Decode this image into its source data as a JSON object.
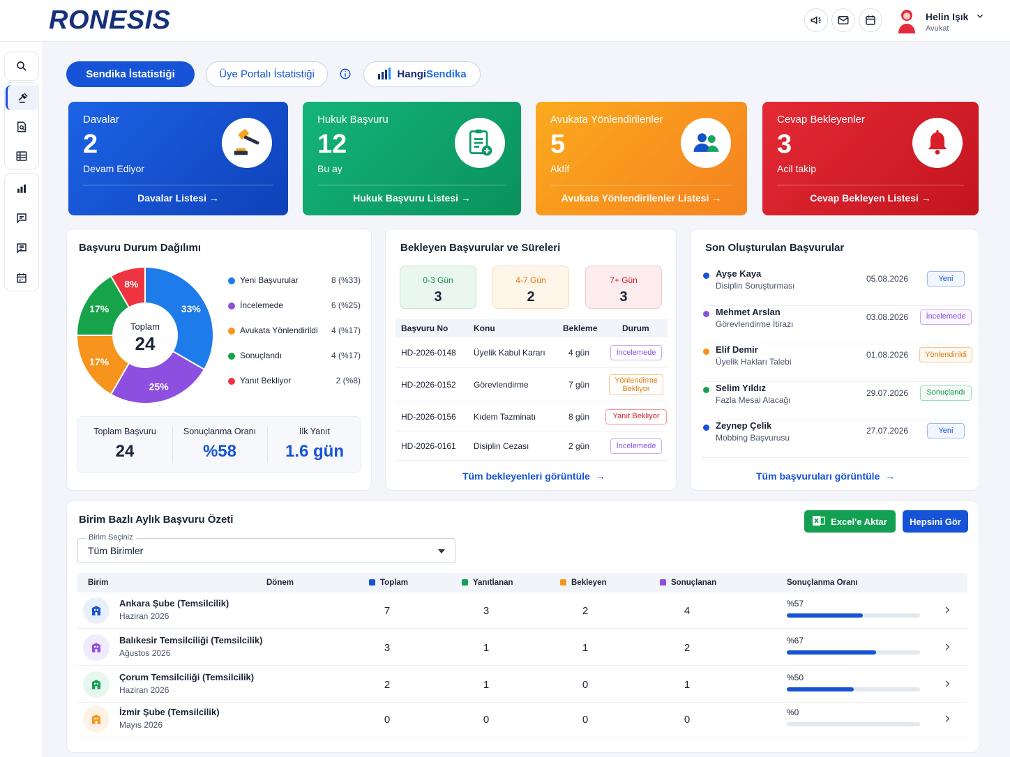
{
  "brand": {
    "logo": "RONESIS"
  },
  "header": {
    "icons": [
      "megaphone-icon",
      "mail-icon",
      "calendar-icon"
    ],
    "user": {
      "name": "Helin Işık",
      "role": "Avukat"
    }
  },
  "tabs": {
    "active": "Sendika İstatistiği",
    "inactive": "Üye Portalı İstatistiği",
    "brand_prefix": "Hangi",
    "brand_suffix": "Sendika"
  },
  "kpis": [
    {
      "title": "Davalar",
      "value": "2",
      "sub": "Devam Ediyor",
      "footer": "Davalar Listesi",
      "icon": "gavel-icon",
      "color": "#1452d4"
    },
    {
      "title": "Hukuk Başvuru",
      "value": "12",
      "sub": "Bu ay",
      "footer": "Hukuk Başvuru Listesi",
      "icon": "document-add-icon",
      "color": "#0fa36b"
    },
    {
      "title": "Avukata Yönlendirilenler",
      "value": "5",
      "sub": "Aktif",
      "footer": "Avukata Yönlendirilenler Listesi",
      "icon": "users-icon",
      "color": "#f7941d"
    },
    {
      "title": "Cevap Bekleyenler",
      "value": "3",
      "sub": "Acil takip",
      "footer": "Cevap Bekleyen Listesi",
      "icon": "bell-icon",
      "color": "#d91e2a"
    }
  ],
  "status_card": {
    "title": "Başvuru Durum Dağılımı",
    "total_label": "Toplam",
    "total_value": "24",
    "stats": [
      {
        "label": "Toplam Başvuru",
        "value": "24"
      },
      {
        "label": "Sonuçlanma Oranı",
        "value": "%58"
      },
      {
        "label": "İlk Yanıt",
        "value": "1.6 gün"
      }
    ]
  },
  "chart_data": {
    "type": "pie",
    "categories": [
      "Yeni Başvurular",
      "İncelemede",
      "Avukata Yönlendirildi",
      "Sonuçlandı",
      "Yanıt Bekliyor"
    ],
    "values": [
      8,
      6,
      4,
      4,
      2
    ],
    "value_labels": [
      "8 (%33)",
      "6 (%25)",
      "4 (%17)",
      "4 (%17)",
      "2 (%8)"
    ],
    "slice_labels": [
      "33%",
      "25%",
      "17%",
      "17%",
      "8%"
    ],
    "colors": [
      "#1e7bea",
      "#8c4fe0",
      "#f7941d",
      "#16a34a",
      "#ef3340"
    ]
  },
  "pending_card": {
    "title": "Bekleyen Başvurular ve Süreleri",
    "buckets": [
      {
        "label": "0-3 Gün",
        "value": "3"
      },
      {
        "label": "4-7 Gün",
        "value": "2"
      },
      {
        "label": "7+ Gün",
        "value": "3"
      }
    ],
    "columns": [
      "Başvuru No",
      "Konu",
      "Bekleme",
      "Durum"
    ],
    "rows": [
      {
        "no": "HD-2026-0148",
        "topic": "Üyelik Kabul Kararı",
        "wait": "4 gün",
        "status": "İncelemede"
      },
      {
        "no": "HD-2026-0152",
        "topic": "Görevlendirme",
        "wait": "7 gün",
        "status": "Yönlendirme Bekliyor"
      },
      {
        "no": "HD-2026-0156",
        "topic": "Kıdem Tazminatı",
        "wait": "8 gün",
        "status": "Yanıt Bekliyor"
      },
      {
        "no": "HD-2026-0161",
        "topic": "Disiplin Cezası",
        "wait": "2 gün",
        "status": "İncelemede"
      }
    ],
    "link": "Tüm bekleyenleri görüntüle"
  },
  "recent_card": {
    "title": "Son Oluşturulan Başvurular",
    "items": [
      {
        "name": "Ayşe Kaya",
        "subject": "Disiplin Soruşturması",
        "date": "05.08.2026",
        "status": "Yeni"
      },
      {
        "name": "Mehmet Arslan",
        "subject": "Görevlendirme İtirazı",
        "date": "03.08.2026",
        "status": "İncelemede"
      },
      {
        "name": "Elif Demir",
        "subject": "Üyelik Hakları Talebi",
        "date": "01.08.2026",
        "status": "Yönlendirildi"
      },
      {
        "name": "Selim Yıldız",
        "subject": "Fazla Mesai Alacağı",
        "date": "29.07.2026",
        "status": "Sonuçlandı"
      },
      {
        "name": "Zeynep Çelik",
        "subject": "Mobbing Başvurusu",
        "date": "27.07.2026",
        "status": "Yeni"
      }
    ],
    "link": "Tüm başvuruları görüntüle"
  },
  "summary": {
    "title": "Birim Bazlı Aylık Başvuru Özeti",
    "excel_label": "Excel'e Aktar",
    "all_label": "Hepsini Gör",
    "select_label": "Birim Seçiniz",
    "select_value": "Tüm Birimler",
    "columns": [
      "Birim",
      "Dönem",
      "Toplam",
      "Yanıtlanan",
      "Bekleyen",
      "Sonuçlanan",
      "Sonuçlanma Oranı"
    ],
    "rows": [
      {
        "name": "Ankara Şube (Temsilcilik)",
        "period": "Haziran 2026",
        "total": "7",
        "answered": "3",
        "pending": "2",
        "resolved": "4",
        "rate_label": "%57",
        "rate": 0.57
      },
      {
        "name": "Balıkesir Temsilciliği (Temsilcilik)",
        "period": "Ağustos 2026",
        "total": "3",
        "answered": "1",
        "pending": "1",
        "resolved": "2",
        "rate_label": "%67",
        "rate": 0.67
      },
      {
        "name": "Çorum Temsilciliği (Temsilcilik)",
        "period": "Haziran 2026",
        "total": "2",
        "answered": "1",
        "pending": "0",
        "resolved": "1",
        "rate_label": "%50",
        "rate": 0.5
      },
      {
        "name": "İzmir Şube (Temsilcilik)",
        "period": "Mayıs 2026",
        "total": "0",
        "answered": "0",
        "pending": "0",
        "resolved": "0",
        "rate_label": "%0",
        "rate": 0
      }
    ]
  }
}
